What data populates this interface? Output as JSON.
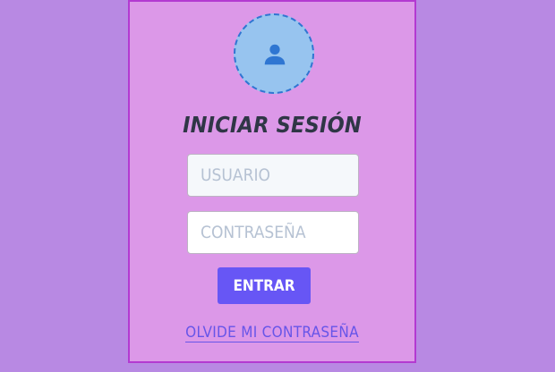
{
  "login": {
    "avatar_icon": "user-icon",
    "title": "INICIAR SESIÓN",
    "username_placeholder": "USUARIO",
    "username_value": "",
    "password_placeholder": "CONTRASEÑA",
    "password_value": "",
    "submit_label": "ENTRAR",
    "forgot_label": "OLVIDE MI CONTRASEÑA"
  },
  "colors": {
    "page_background": "#b889e3",
    "card_background": "#dc98e8",
    "card_border": "#b33ad1",
    "avatar_background": "#97c4ef",
    "avatar_icon": "#2f76d2",
    "title_text": "#2f3646",
    "button": "#6756f5",
    "link": "#6755e8"
  }
}
